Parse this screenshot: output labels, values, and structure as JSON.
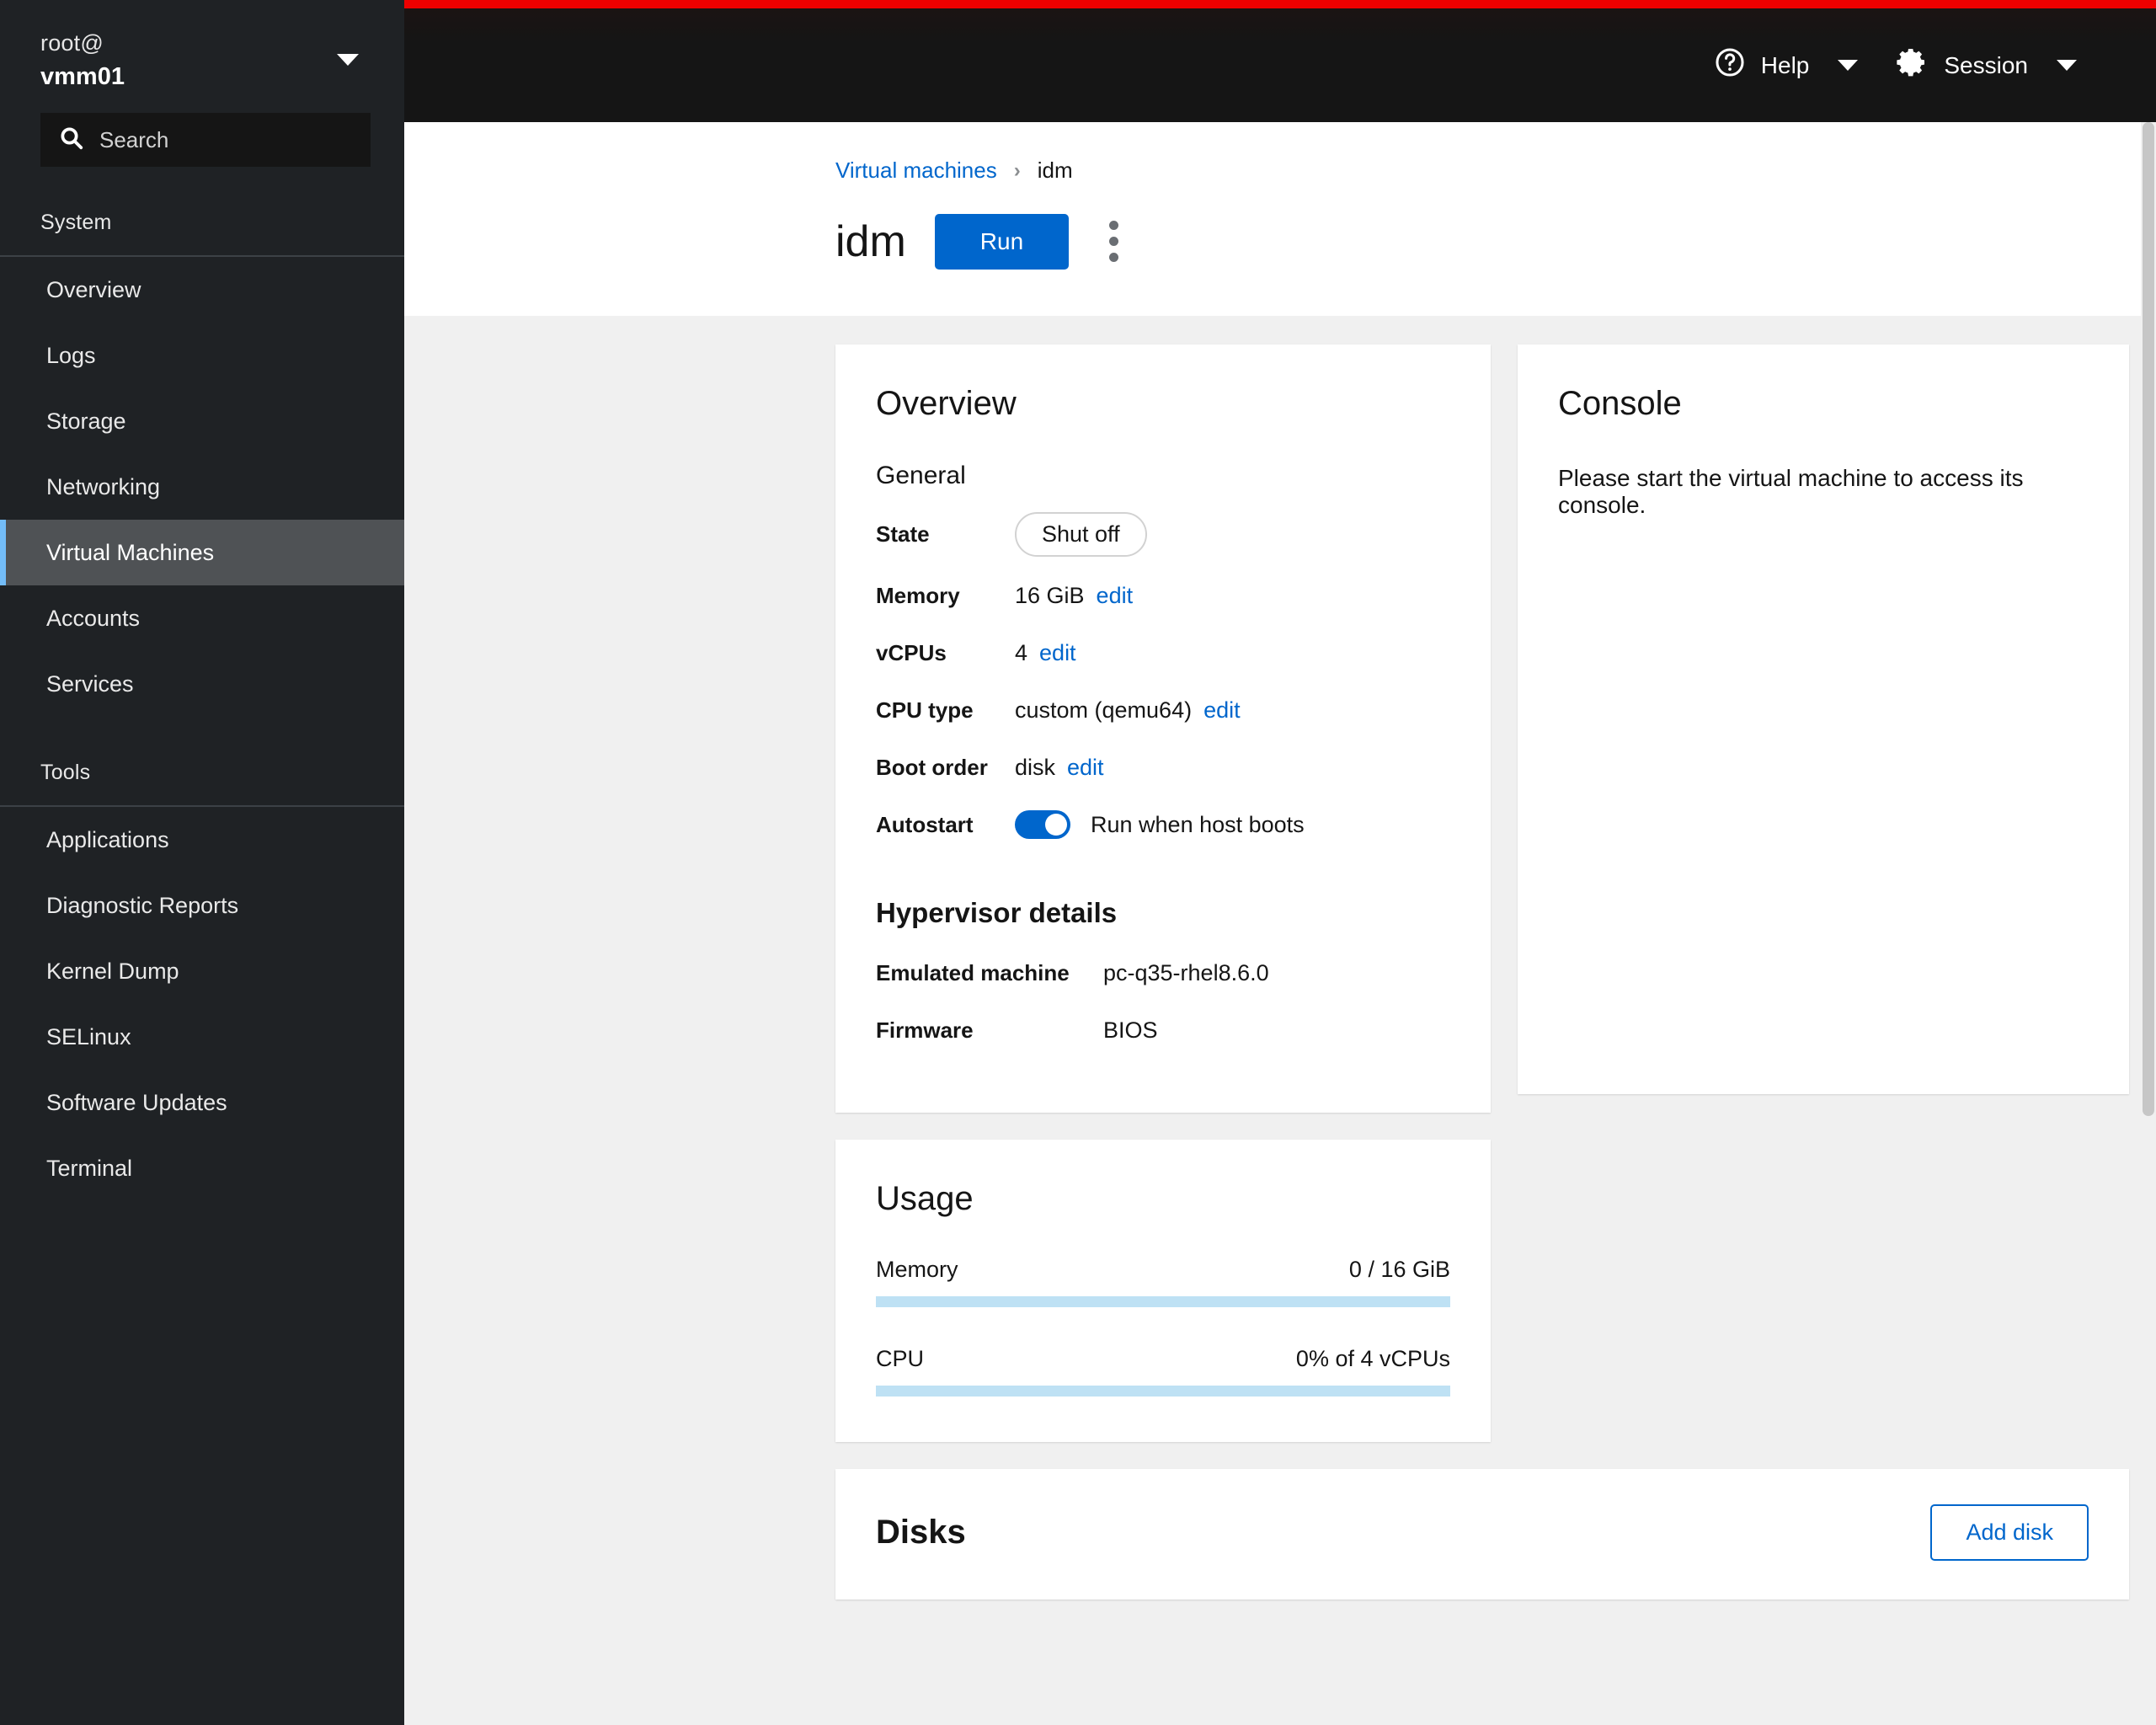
{
  "sidebar": {
    "host_user": "root@",
    "host_name": "vmm01",
    "search_placeholder": "Search",
    "groups": [
      {
        "label": "System",
        "items": [
          {
            "label": "Overview",
            "active": false
          },
          {
            "label": "Logs",
            "active": false
          },
          {
            "label": "Storage",
            "active": false
          },
          {
            "label": "Networking",
            "active": false
          },
          {
            "label": "Virtual Machines",
            "active": true
          },
          {
            "label": "Accounts",
            "active": false
          },
          {
            "label": "Services",
            "active": false
          }
        ]
      },
      {
        "label": "Tools",
        "items": [
          {
            "label": "Applications",
            "active": false
          },
          {
            "label": "Diagnostic Reports",
            "active": false
          },
          {
            "label": "Kernel Dump",
            "active": false
          },
          {
            "label": "SELinux",
            "active": false
          },
          {
            "label": "Software Updates",
            "active": false
          },
          {
            "label": "Terminal",
            "active": false
          }
        ]
      }
    ]
  },
  "topbar": {
    "help_label": "Help",
    "session_label": "Session",
    "accent_color": "#ee0000"
  },
  "header": {
    "breadcrumb_parent": "Virtual machines",
    "breadcrumb_separator": "›",
    "breadcrumb_current": "idm",
    "title": "idm",
    "run_label": "Run",
    "primary_color": "#0066cc"
  },
  "overview": {
    "title": "Overview",
    "general_label": "General",
    "rows": [
      {
        "key": "State",
        "value": "Shut off"
      },
      {
        "key": "Memory",
        "value": "16 GiB",
        "edit": "edit"
      },
      {
        "key": "vCPUs",
        "value": "4",
        "edit": "edit"
      },
      {
        "key": "CPU type",
        "value": "custom (qemu64)",
        "edit": "edit"
      },
      {
        "key": "Boot order",
        "value": "disk",
        "edit": "edit"
      },
      {
        "key": "Autostart",
        "value": "Run when host boots",
        "toggle_on": true
      }
    ],
    "hypervisor_title": "Hypervisor details",
    "hypervisor_rows": [
      {
        "key": "Emulated machine",
        "value": "pc-q35-rhel8.6.0"
      },
      {
        "key": "Firmware",
        "value": "BIOS"
      }
    ]
  },
  "usage": {
    "title": "Usage",
    "metrics": [
      {
        "label": "Memory",
        "value": "0 / 16 GiB",
        "percent": 0
      },
      {
        "label": "CPU",
        "value": "0% of 4 vCPUs",
        "percent": 0
      }
    ]
  },
  "console": {
    "title": "Console",
    "message": "Please start the virtual machine to access its console."
  },
  "disks": {
    "title": "Disks",
    "add_label": "Add disk"
  }
}
